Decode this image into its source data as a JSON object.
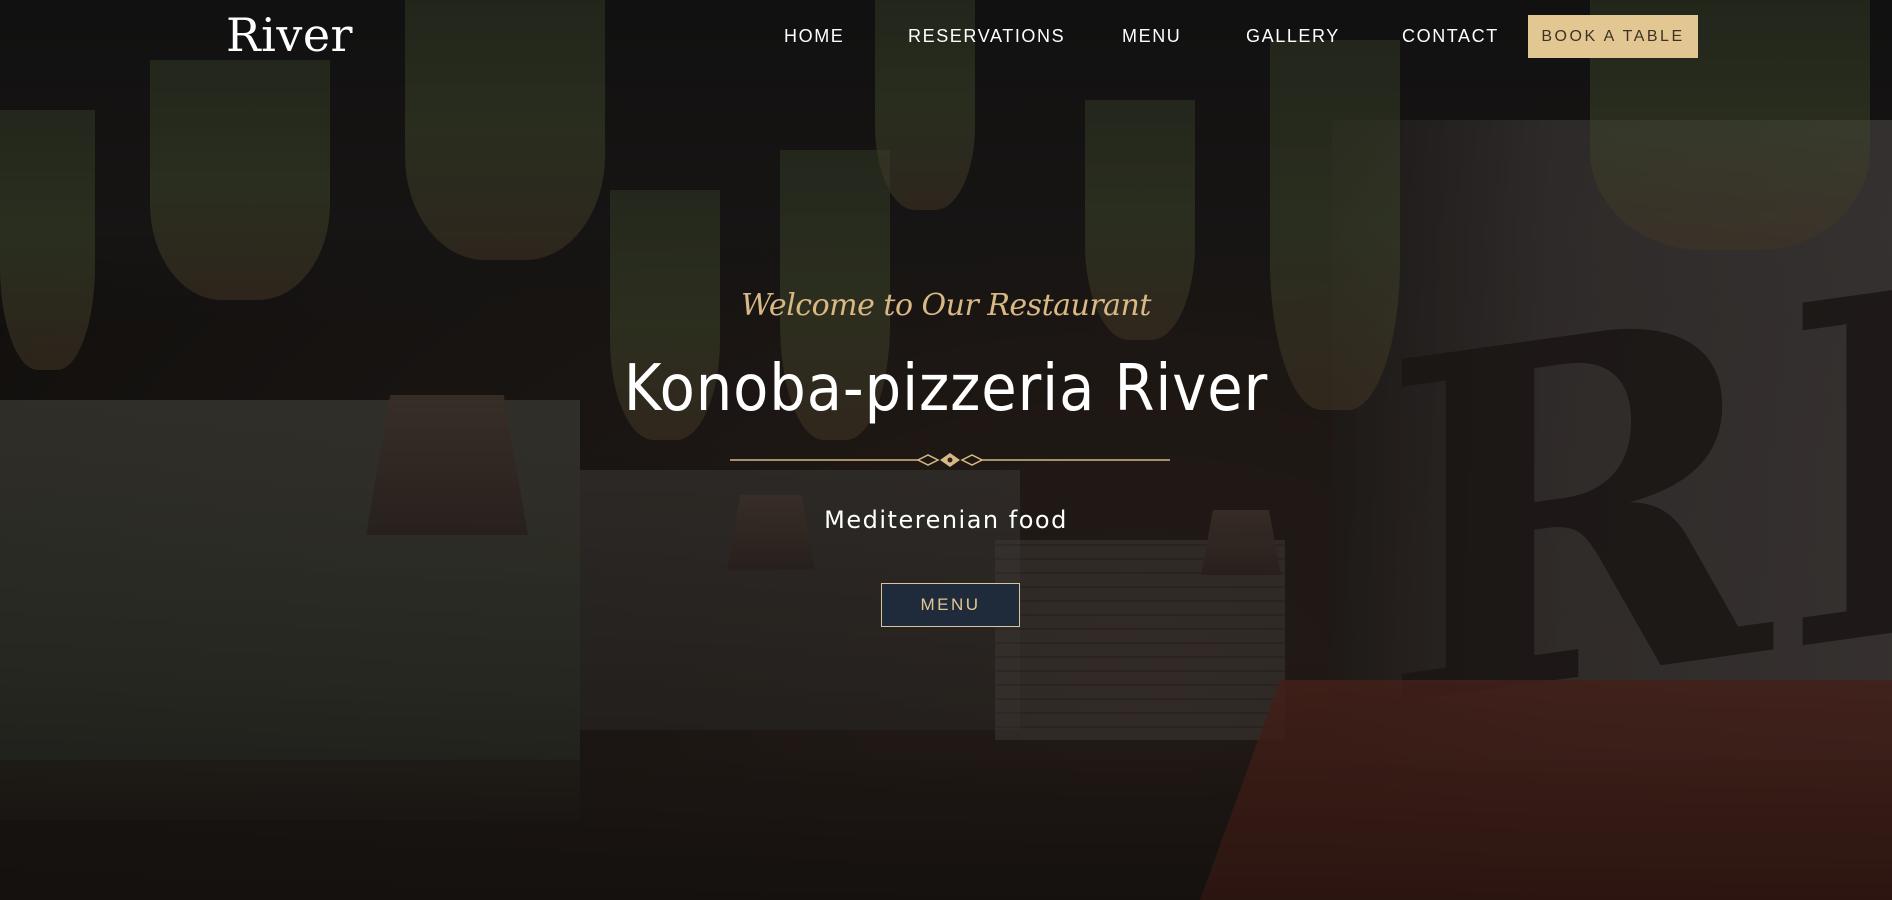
{
  "nav": {
    "logo": "River",
    "links": [
      "HOME",
      "RESERVATIONS",
      "MENU",
      "GALLERY",
      "CONTACT"
    ],
    "cta": "BOOK A TABLE"
  },
  "hero": {
    "welcome": "Welcome to Our Restaurant",
    "title": "Konoba-pizzeria River",
    "subtitle": "Mediterenian food",
    "button": "MENU",
    "wall_text": "RIVER",
    "divider_icon": "ornament-divider-icon"
  },
  "colors": {
    "accent": "#e3c793",
    "button_bg": "#1f2a3a",
    "text": "#ffffff"
  }
}
